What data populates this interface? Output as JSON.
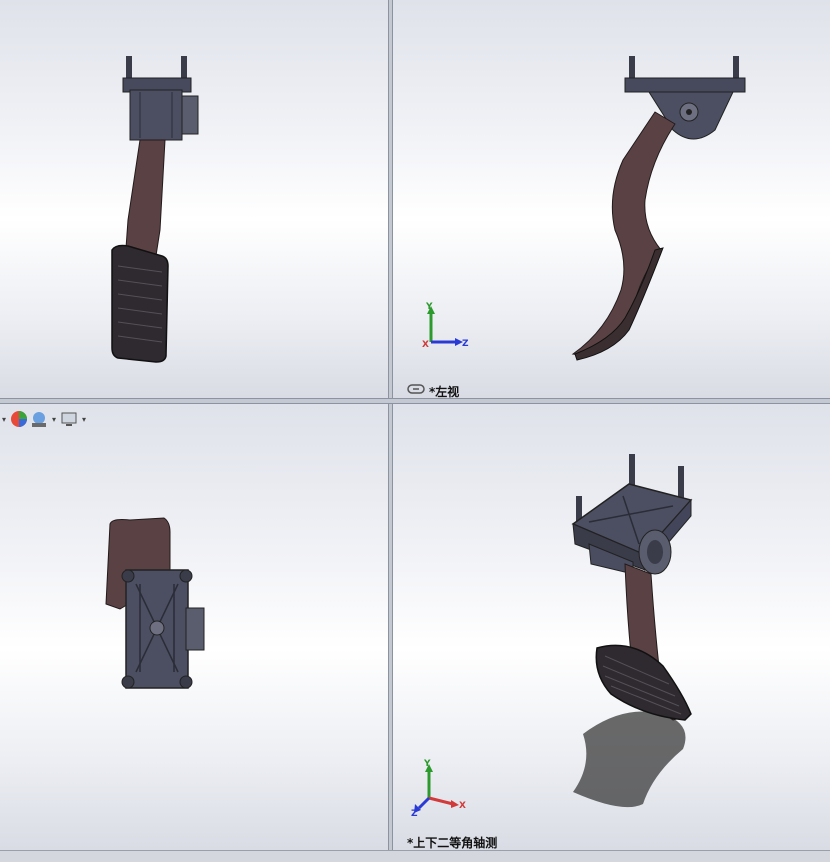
{
  "viewports": {
    "front": {
      "label": ""
    },
    "left": {
      "label": "*左视"
    },
    "top": {
      "label": ""
    },
    "iso": {
      "label": "*上下二等角轴测"
    }
  },
  "triad": {
    "x": "X",
    "y": "Y",
    "z": "Z"
  },
  "colors": {
    "pedal_arm": "#5c4446",
    "housing": "#4a4d60",
    "x_axis": "#d23a3a",
    "y_axis": "#2d9a2d",
    "z_axis": "#2a3ad4"
  }
}
